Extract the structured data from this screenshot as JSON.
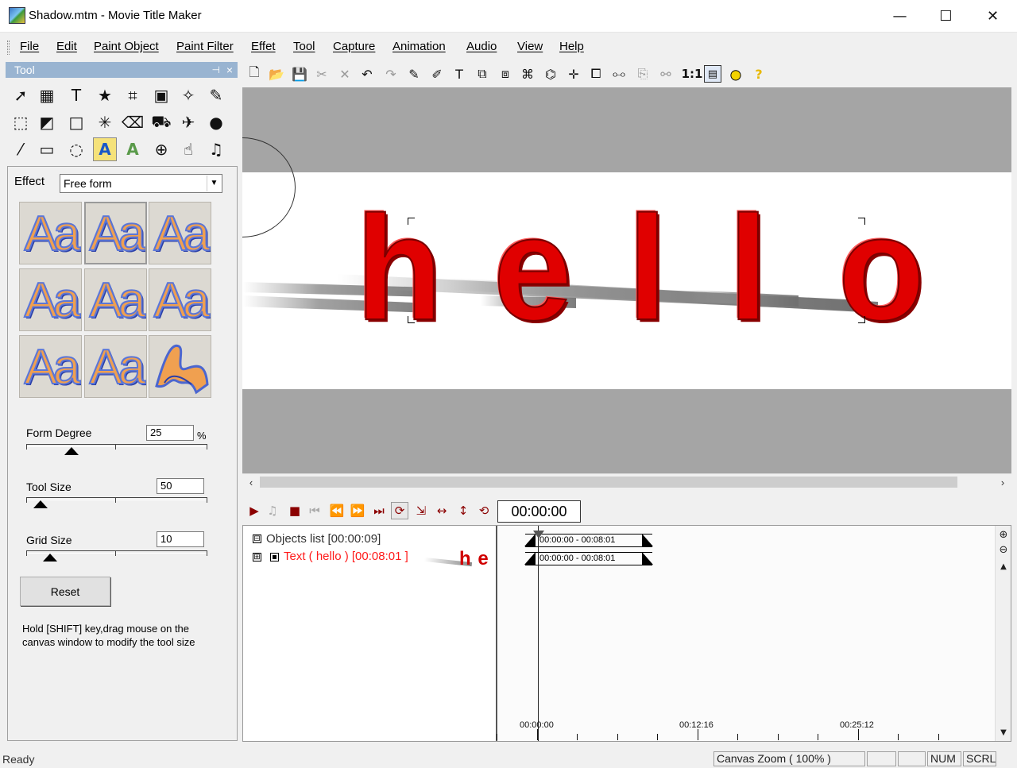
{
  "window": {
    "title": "Shadow.mtm - Movie Title Maker",
    "minimize_glyph": "—",
    "maximize_glyph": "☐",
    "close_glyph": "✕"
  },
  "menu": [
    "File",
    "Edit",
    "Paint Object",
    "Paint Filter",
    "Effet",
    "Tool",
    "Capture",
    "Animation",
    "Audio",
    "View",
    "Help"
  ],
  "tool_panel": {
    "title": "Tool",
    "pin_glyph": "⊣",
    "close_glyph": "×",
    "tools": [
      {
        "name": "pointer-tool-icon",
        "glyph": "➚"
      },
      {
        "name": "color-picker-tool-icon",
        "glyph": "▦"
      },
      {
        "name": "text-tool-icon",
        "glyph": "T"
      },
      {
        "name": "star-tool-icon",
        "glyph": "★"
      },
      {
        "name": "transform-tool-icon",
        "glyph": "⌗"
      },
      {
        "name": "image-tool-icon",
        "glyph": "▣"
      },
      {
        "name": "magic-wand-tool-icon",
        "glyph": "✧"
      },
      {
        "name": "pen-tool-icon",
        "glyph": "✎"
      },
      {
        "name": "select-region-tool-icon",
        "glyph": "⬚"
      },
      {
        "name": "fill-select-tool-icon",
        "glyph": "◩"
      },
      {
        "name": "rectangle-tool-icon",
        "glyph": "□"
      },
      {
        "name": "sparkle-wand-tool-icon",
        "glyph": "✳"
      },
      {
        "name": "eraser-tool-icon",
        "glyph": "⌫"
      },
      {
        "name": "paint-bucket-tool-icon",
        "glyph": "⛟"
      },
      {
        "name": "spray-tool-icon",
        "glyph": "✈"
      },
      {
        "name": "drop-tool-icon",
        "glyph": "●"
      },
      {
        "name": "eyedropper-tool-icon",
        "glyph": "⁄"
      },
      {
        "name": "frame-tool-icon",
        "glyph": "▭"
      },
      {
        "name": "smudge-tool-icon",
        "glyph": "◌"
      },
      {
        "name": "text-effect-tool-icon",
        "glyph": "A"
      },
      {
        "name": "text-outline-tool-icon",
        "glyph": "A"
      },
      {
        "name": "zoom-tool-icon",
        "glyph": "⊕"
      },
      {
        "name": "hand-tool-icon",
        "glyph": "☝"
      },
      {
        "name": "audio-tool-icon",
        "glyph": "♫"
      }
    ]
  },
  "properties": {
    "effect_label": "Effect",
    "effect_value": "Free form",
    "effect_arrow": "▼",
    "preset_text": "Aa",
    "presets_selected": 1,
    "form_degree": {
      "label": "Form Degree",
      "value": "25",
      "unit": "%",
      "level": 0.25
    },
    "tool_size": {
      "label": "Tool Size",
      "value": "50",
      "level": 0.08
    },
    "grid_size": {
      "label": "Grid Size",
      "value": "10",
      "level": 0.13
    },
    "reset_label": "Reset",
    "hint": "Hold [SHIFT] key,drag mouse on the canvas window to modify the tool size"
  },
  "main_toolbar": {
    "zoom_label": "1:1",
    "icons": [
      {
        "name": "new-file-icon",
        "glyph": "🗋"
      },
      {
        "name": "open-folder-icon",
        "glyph": "📂"
      },
      {
        "name": "save-icon",
        "glyph": "💾"
      },
      {
        "name": "cut-icon",
        "glyph": "✂",
        "dim": true
      },
      {
        "name": "delete-icon",
        "glyph": "✕",
        "dim": true
      },
      {
        "name": "undo-icon",
        "glyph": "↶"
      },
      {
        "name": "redo-icon",
        "glyph": "↷",
        "dim": true
      },
      {
        "name": "brush-add-icon",
        "glyph": "✎"
      },
      {
        "name": "brush-remove-icon",
        "glyph": "✐"
      },
      {
        "name": "text-bold-icon",
        "glyph": "T"
      },
      {
        "name": "object-split-icon",
        "glyph": "⧉"
      },
      {
        "name": "object-merge-icon",
        "glyph": "⧈"
      },
      {
        "name": "object-group-icon",
        "glyph": "⌘"
      },
      {
        "name": "object-ungroup-icon",
        "glyph": "⌬"
      },
      {
        "name": "align-center-icon",
        "glyph": "✛"
      },
      {
        "name": "bring-forward-icon",
        "glyph": "⧠"
      },
      {
        "name": "send-backward-icon",
        "glyph": "⧟"
      },
      {
        "name": "layer-toggle-icon",
        "glyph": "⎘",
        "dim": true
      },
      {
        "name": "wand-icon",
        "glyph": "⚯",
        "dim": true
      },
      {
        "name": "zoom-fit-icon",
        "glyph": "1:1"
      },
      {
        "name": "properties-icon",
        "glyph": "▤"
      },
      {
        "name": "circle-icon",
        "glyph": "●"
      },
      {
        "name": "help-icon",
        "glyph": "?"
      }
    ]
  },
  "canvas": {
    "text": [
      "h",
      "e",
      "l",
      "l",
      "o"
    ]
  },
  "scroll": {
    "left_glyph": "‹",
    "right_glyph": "›",
    "up_glyph": "▲",
    "down_glyph": "▼"
  },
  "playback": {
    "time": "00:00:00",
    "buttons": [
      {
        "name": "play-icon",
        "glyph": "▶"
      },
      {
        "name": "music-icon",
        "glyph": "♫",
        "dim": true
      },
      {
        "name": "stop-icon",
        "glyph": "■"
      },
      {
        "name": "skip-start-icon",
        "glyph": "⏮",
        "dim": true
      },
      {
        "name": "rewind-icon",
        "glyph": "⏪",
        "dim": true
      },
      {
        "name": "fast-forward-icon",
        "glyph": "⏩"
      },
      {
        "name": "skip-end-icon",
        "glyph": "⏭"
      },
      {
        "name": "loop-icon",
        "glyph": "⟳",
        "boxed": true
      },
      {
        "name": "cursor-play-icon",
        "glyph": "⇲"
      },
      {
        "name": "stretch-horizontal-icon",
        "glyph": "↔"
      },
      {
        "name": "stretch-vertical-icon",
        "glyph": "↕"
      },
      {
        "name": "repeat-icon",
        "glyph": "⟲"
      }
    ]
  },
  "timeline": {
    "objects_list": "Objects list [00:00:09]",
    "object_item": "Text ( hello ) [00:08:01 ]",
    "thumb_text": "h e",
    "expand_glyph": "⊟",
    "collapse_glyph": "⊞",
    "tracks": [
      "00:00:00 - 00:08:01",
      "00:00:00 - 00:08:01"
    ],
    "ruler_labels": [
      "00:00:00",
      "00:12:16",
      "00:25:12"
    ],
    "zoom_in_glyph": "⊕",
    "zoom_out_glyph": "⊖"
  },
  "status": {
    "ready": "Ready",
    "canvas_zoom": "Canvas Zoom ( 100% )",
    "num": "NUM",
    "scrl": "SCRL"
  }
}
